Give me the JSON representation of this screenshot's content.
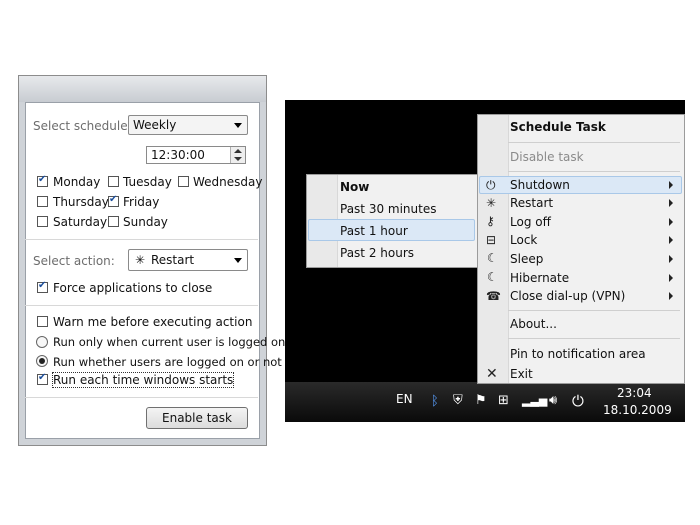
{
  "dialog": {
    "schedule_label": "Select schedule:",
    "schedule_value": "Weekly",
    "time_value": "12:30:00",
    "days": [
      {
        "label": "Monday",
        "checked": true
      },
      {
        "label": "Tuesday",
        "checked": false
      },
      {
        "label": "Wednesday",
        "checked": false
      },
      {
        "label": "Thursday",
        "checked": false
      },
      {
        "label": "Friday",
        "checked": true
      },
      {
        "label": "Saturday",
        "checked": false
      },
      {
        "label": "Sunday",
        "checked": false
      }
    ],
    "action_label": "Select action:",
    "action_value": "Restart",
    "force_close": "Force applications to close",
    "warn": "Warn me before executing action",
    "run_logged_on": "Run only when current user is logged on",
    "run_whether": "Run whether users are logged on or not",
    "run_each_start": "Run each time windows starts",
    "enable_button": "Enable task"
  },
  "context_menu": {
    "title": "Schedule Task",
    "disable": "Disable task",
    "items": [
      {
        "label": "Shutdown",
        "icon": "power-icon"
      },
      {
        "label": "Restart",
        "icon": "restart-icon"
      },
      {
        "label": "Log off",
        "icon": "key-icon"
      },
      {
        "label": "Lock",
        "icon": "lock-icon"
      },
      {
        "label": "Sleep",
        "icon": "moon-icon"
      },
      {
        "label": "Hibernate",
        "icon": "moon-icon"
      },
      {
        "label": "Close dial-up (VPN)",
        "icon": "phone-icon"
      }
    ],
    "about": "About...",
    "pin": "Pin to notification area",
    "exit": "Exit"
  },
  "submenu": {
    "items": [
      "Now",
      "Past 30 minutes",
      "Past 1 hour",
      "Past 2 hours"
    ],
    "highlighted": "Past 1 hour"
  },
  "taskbar": {
    "language": "EN",
    "time": "23:04",
    "date": "18.10.2009"
  },
  "colors": {
    "highlight": "#dbe8f6",
    "checkmark": "#1c4f9c"
  }
}
